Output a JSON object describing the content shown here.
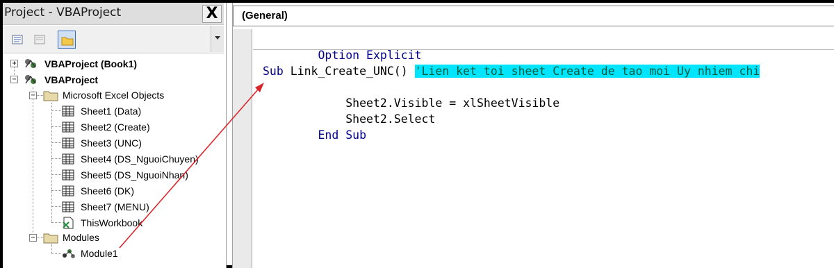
{
  "project": {
    "title": "Project - VBAProject",
    "close_label": "X",
    "tree": {
      "vbaproject_book1": "VBAProject (Book1)",
      "vbaproject_current": "VBAProject",
      "excel_objects": "Microsoft Excel Objects",
      "sheets": [
        "Sheet1 (Data)",
        "Sheet2 (Create)",
        "Sheet3 (UNC)",
        "Sheet4 (DS_NguoiChuyen)",
        "Sheet5 (DS_NguoiNhan)",
        "Sheet6 (DK)",
        "Sheet7 (MENU)"
      ],
      "this_workbook": "ThisWorkbook",
      "modules": "Modules",
      "module1": "Module1"
    },
    "icons": {
      "view_code": "view-code-icon",
      "view_object": "view-object-icon",
      "toggle_folders": "folder-icon",
      "project": "vba-project-icon",
      "folder": "folder-icon",
      "sheet": "sheet-icon",
      "workbook": "workbook-icon",
      "module": "module-icon"
    }
  },
  "code": {
    "object_combo": "(General)",
    "lines": {
      "l1_kw": "Option Explicit",
      "l3_kw": "Sub",
      "l3_name": " Link_Create_UNC() ",
      "l3_comment": "'Lien ket toi sheet Create de tao moi Uy nhiem chi",
      "l4": "    Sheet2.Visible = xlSheetVisible",
      "l5": "    Sheet2.Select",
      "l6_kw": "End Sub"
    }
  },
  "colors": {
    "comment_highlight": "#00e5ff",
    "keyword": "#00008b",
    "arrow": "#d9262c"
  }
}
